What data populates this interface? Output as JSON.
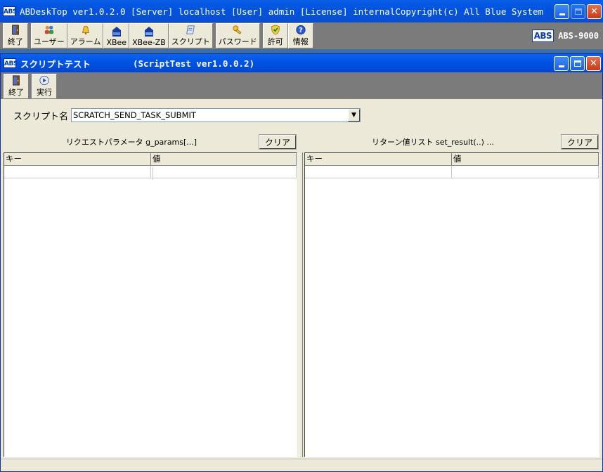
{
  "main_window": {
    "logo_text": "ABS",
    "title": "ABDeskTop ver1.0.2.0  [Server] localhost  [User] admin  [License] internal",
    "copyright": "Copyright(c) All Blue System"
  },
  "main_toolbar": {
    "exit": "終了",
    "user": "ユーザー",
    "alarm": "アラーム",
    "xbee": "XBee",
    "xbee_zb": "XBee-ZB",
    "script": "スクリプト",
    "password": "パスワード",
    "permit": "許可",
    "info": "情報"
  },
  "brand": {
    "logo_text": "ABS",
    "model": "ABS-9000"
  },
  "inner_window": {
    "logo_text": "ABS",
    "title": "スクリプトテスト",
    "subtitle": "(ScriptTest ver1.0.0.2)"
  },
  "inner_toolbar": {
    "exit": "終了",
    "run": "実行"
  },
  "script": {
    "label": "スクリプト名",
    "selected": "SCRATCH_SEND_TASK_SUBMIT"
  },
  "request_pane": {
    "caption": "リクエストパラメータ g_params[...]",
    "clear_label": "クリア",
    "columns": [
      "キー",
      "値"
    ]
  },
  "result_pane": {
    "caption": "リターン値リスト set_result(..) ...",
    "clear_label": "クリア",
    "columns": [
      "キー",
      "値"
    ]
  },
  "colors": {
    "titlebar": "#0055e5",
    "toolbar": "#7b7b7b",
    "face": "#ece9d8",
    "close": "#c63b17"
  }
}
